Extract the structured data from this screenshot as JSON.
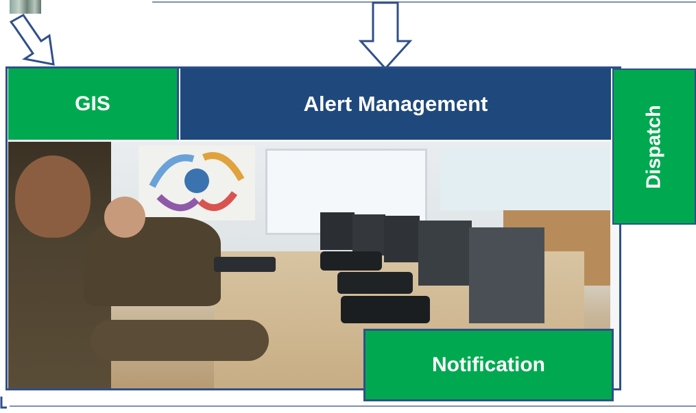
{
  "labels": {
    "gis": "GIS",
    "alert_management": "Alert Management",
    "dispatch": "Dispatch",
    "notification": "Notification"
  },
  "colors": {
    "green": "#00a94f",
    "navy": "#1f497d",
    "border": "#2f4f8a"
  },
  "photo": {
    "description_icon": "control-room-photo"
  }
}
